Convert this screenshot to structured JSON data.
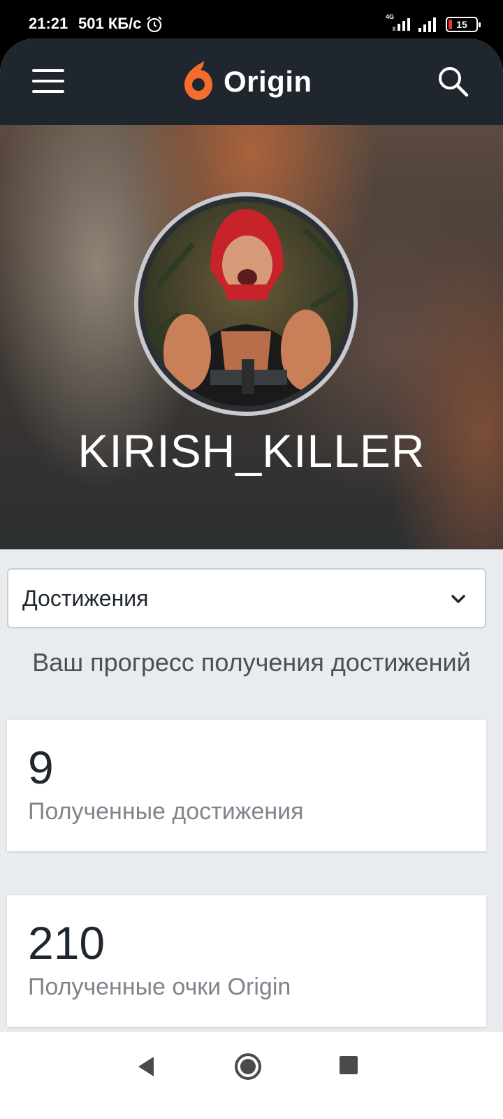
{
  "status_bar": {
    "time": "21:21",
    "speed": "501 КБ/с",
    "network": "4G",
    "battery": "15"
  },
  "header": {
    "logo_text": "Origin",
    "menu_icon": "hamburger-menu-icon",
    "search_icon": "search-icon",
    "accent": "#f56c2d"
  },
  "profile": {
    "username": "KIRISH_KILLER"
  },
  "dropdown": {
    "selected": "Достижения"
  },
  "progress": {
    "title": "Ваш прогресс получения достижений"
  },
  "stats": [
    {
      "value": "9",
      "caption": "Полученные достижения"
    },
    {
      "value": "210",
      "caption": "Полученные очки Origin"
    }
  ]
}
